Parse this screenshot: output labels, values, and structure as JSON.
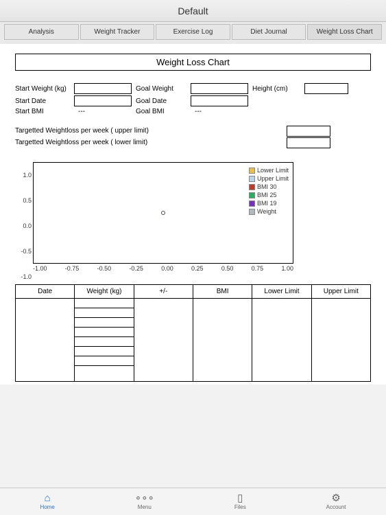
{
  "header": {
    "title": "Default"
  },
  "tabs": {
    "items": [
      "Analysis",
      "Weight Tracker",
      "Exercise Log",
      "Diet Journal",
      "Weight Loss Chart"
    ],
    "active": 4
  },
  "section": {
    "title": "Weight Loss Chart"
  },
  "fields": {
    "start_weight_label": "Start Weight (kg)",
    "goal_weight_label": "Goal Weight",
    "height_label": "Height (cm)",
    "start_date_label": "Start Date",
    "goal_date_label": "Goal Date",
    "start_bmi_label": "Start BMI",
    "goal_bmi_label": "Goal BMI",
    "start_bmi_value": "---",
    "goal_bmi_value": "---"
  },
  "targets": {
    "upper_label": "Targetted Weightloss per week ( upper limit)",
    "lower_label": "Targetted Weightloss per week ( lower limit)"
  },
  "chart_data": {
    "type": "scatter",
    "title": "",
    "xlabel": "",
    "ylabel": "",
    "xlim": [
      -1.0,
      1.0
    ],
    "ylim": [
      -1.0,
      1.0
    ],
    "xticks": [
      "-1.00",
      "-0.75",
      "-0.50",
      "-0.25",
      "0.00",
      "0.25",
      "0.50",
      "0.75",
      "1.00"
    ],
    "yticks": [
      "1.0",
      "0.5",
      "0.0",
      "-0.5",
      "-1.0"
    ],
    "series": [
      {
        "name": "Lower Limit",
        "color": "#e6c04d",
        "values": []
      },
      {
        "name": "Upper Limit",
        "color": "#bcd4e6",
        "values": []
      },
      {
        "name": "BMI 30",
        "color": "#c0392b",
        "values": []
      },
      {
        "name": "BMI 25",
        "color": "#27ae60",
        "values": []
      },
      {
        "name": "BMI 19",
        "color": "#7b2fbf",
        "values": []
      },
      {
        "name": "Weight",
        "color": "#b0b8c0",
        "values": [
          [
            0,
            0
          ]
        ]
      }
    ]
  },
  "table": {
    "columns": [
      "Date",
      "Weight (kg)",
      "+/-",
      "BMI",
      "Lower Limit",
      "Upper Limit"
    ],
    "weight_rows": 8
  },
  "bottom": {
    "items": [
      {
        "label": "Home",
        "icon": "⌂",
        "active": true
      },
      {
        "label": "Menu",
        "icon": "∘∘∘",
        "active": false
      },
      {
        "label": "Files",
        "icon": "▯",
        "active": false
      },
      {
        "label": "Account",
        "icon": "⚙",
        "active": false
      }
    ]
  }
}
